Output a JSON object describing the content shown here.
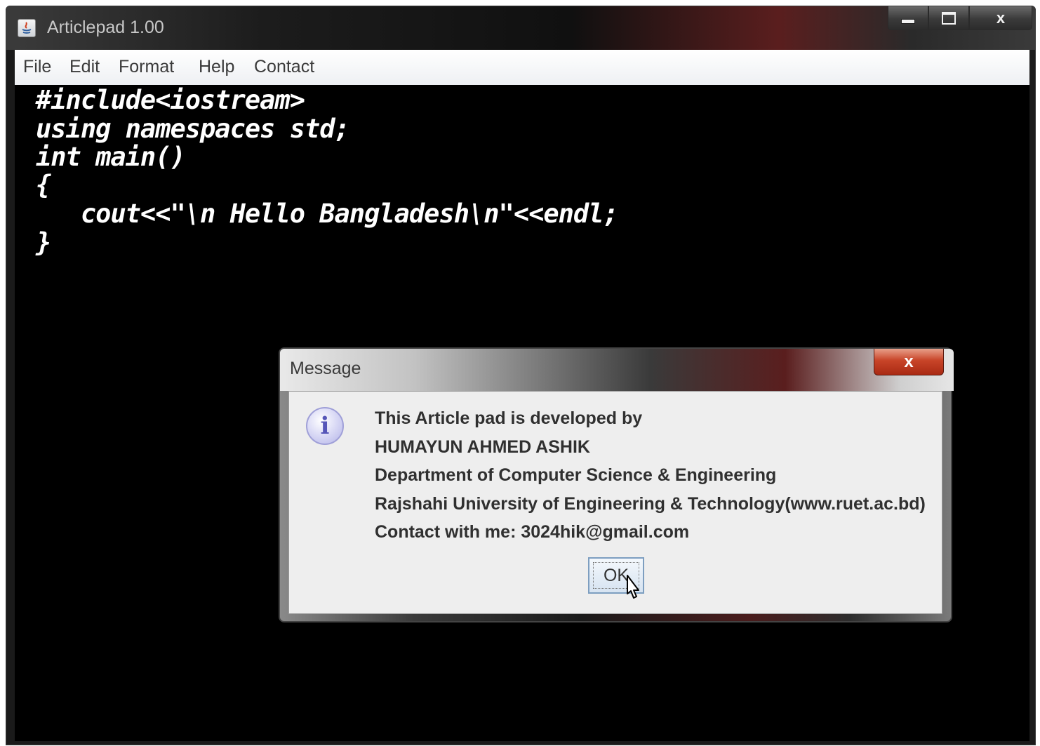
{
  "window": {
    "title": "Articlepad 1.00",
    "controls": {
      "minimize": "minimize",
      "maximize": "maximize",
      "close": "x"
    }
  },
  "menu": [
    "File",
    "Edit",
    "Format",
    "Help",
    "Contact"
  ],
  "editor": {
    "lines": [
      "#include<iostream>",
      "using namespaces std;",
      "int main()",
      "{",
      "   cout<<\"\\n Hello Bangladesh\\n\"<<endl;",
      "}"
    ]
  },
  "dialog": {
    "title": "Message",
    "close_label": "x",
    "icon": "info-icon",
    "lines": [
      "This Article pad is developed by",
      "HUMAYUN AHMED ASHIK",
      "Department of Computer Science & Engineering",
      "Rajshahi University of Engineering & Technology(www.ruet.ac.bd)",
      "Contact with me: 3024hik@gmail.com"
    ],
    "ok_label": "OK"
  },
  "colors": {
    "editor_bg": "#000000",
    "code_text": "#ffffff",
    "dialog_body": "#eeeeee",
    "close_button": "#c84428",
    "ok_border": "#7d9ec0"
  }
}
